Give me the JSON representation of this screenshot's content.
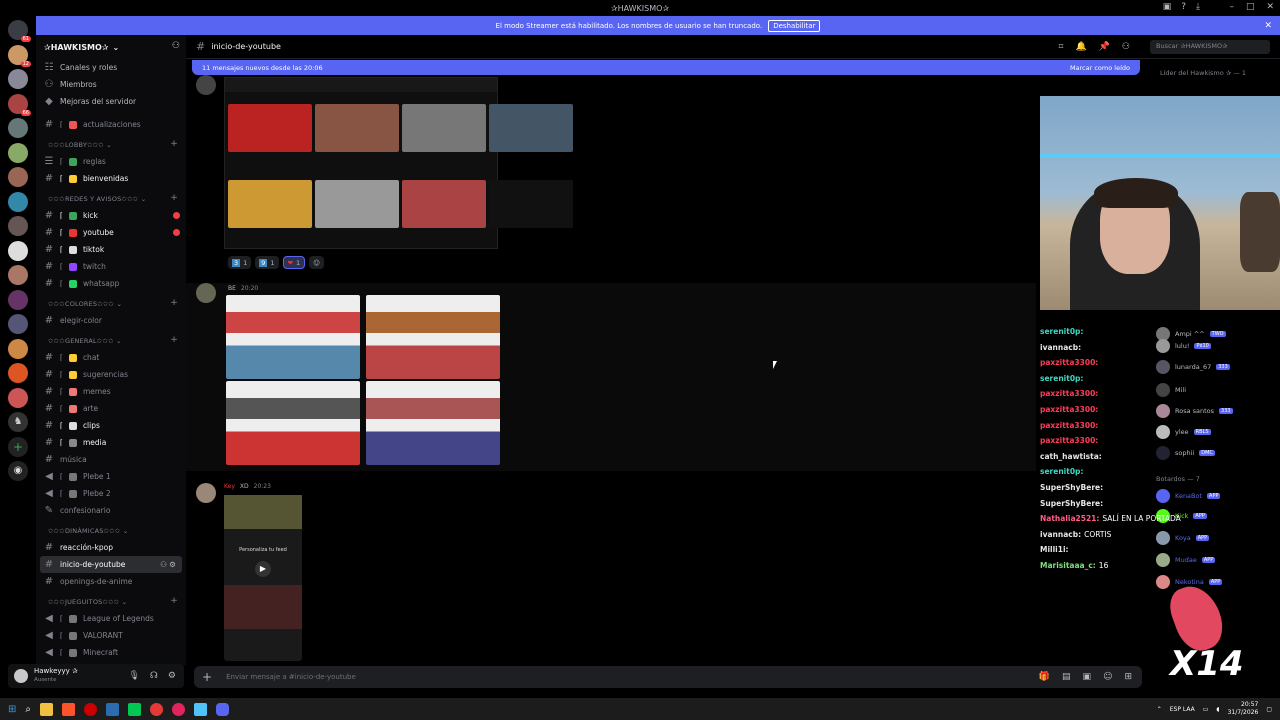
{
  "window": {
    "title": "✰HAWKISMO✰"
  },
  "banner": {
    "text": "El modo Streamer está habilitado. Los nombres de usuario se han truncado.",
    "button": "Deshabilitar"
  },
  "server": {
    "name": "✰HAWKISMO✰"
  },
  "sidebar": {
    "top": [
      "Canales y roles",
      "Miembros",
      "Mejoras del servidor"
    ],
    "channels_pre": [
      {
        "label": "actualizaciones"
      }
    ],
    "cat_lobby": "LOBBY",
    "lobby": [
      {
        "label": "reglas"
      },
      {
        "label": "bienvenidas"
      }
    ],
    "cat_redes": "REDES Y AVISOS",
    "redes": [
      {
        "label": "kick"
      },
      {
        "label": "youtube"
      },
      {
        "label": "tiktok"
      },
      {
        "label": "twitch"
      },
      {
        "label": "whatsapp"
      }
    ],
    "cat_colores": "COLORES",
    "colores": [
      {
        "label": "elegir-color"
      }
    ],
    "cat_general": "GENERAL",
    "general": [
      {
        "label": "chat"
      },
      {
        "label": "sugerencias"
      },
      {
        "label": "memes"
      },
      {
        "label": "arte"
      },
      {
        "label": "clips"
      },
      {
        "label": "media"
      },
      {
        "label": "música"
      },
      {
        "label": "Plebe 1"
      },
      {
        "label": "Plebe 2"
      },
      {
        "label": "confesionario"
      }
    ],
    "cat_dinamicas": "DINÁMICAS",
    "dinamicas": [
      {
        "label": "reacción-kpop"
      },
      {
        "label": "inicio-de-youtube"
      },
      {
        "label": "openings-de-anime"
      }
    ],
    "cat_juegos": "JUEGUITOS",
    "juegos": [
      {
        "label": "League of Legends"
      },
      {
        "label": "VALORANT"
      },
      {
        "label": "Minecraft"
      }
    ]
  },
  "user": {
    "name": "Hawkeyyy ✰",
    "status": "Ausente"
  },
  "channel": {
    "name": "inicio-de-youtube",
    "search_placeholder": "Buscar ✰HAWKISMO✰"
  },
  "newbar": {
    "text": "11 mensajes nuevos desde las 20:06",
    "mark": "Marcar como leído"
  },
  "reactions": [
    {
      "emoji": "3",
      "count": "1"
    },
    {
      "emoji": "9",
      "count": "1"
    },
    {
      "emoji": "❤",
      "count": "1"
    }
  ],
  "messages": [
    {
      "time": "20:20",
      "tag": "BE"
    },
    {
      "author": "Key",
      "time": "20:23",
      "tag": "XD"
    }
  ],
  "composer": {
    "placeholder": "Enviar mensaje a #inicio-de-youtube"
  },
  "chat": [
    {
      "user": "serenit0p:",
      "text": "",
      "color": "#3fd7c0"
    },
    {
      "user": "ivannacb:",
      "text": "",
      "color": "#e6e6e6"
    },
    {
      "user": "paxzitta3300:",
      "text": "",
      "color": "#ff3c5a"
    },
    {
      "user": "serenit0p:",
      "text": "",
      "color": "#3fd7c0"
    },
    {
      "user": "paxzitta3300:",
      "text": "",
      "color": "#ff3c5a"
    },
    {
      "user": "paxzitta3300:",
      "text": "",
      "color": "#ff3c5a"
    },
    {
      "user": "paxzitta3300:",
      "text": "",
      "color": "#ff3c5a"
    },
    {
      "user": "paxzitta3300:",
      "text": "",
      "color": "#ff3c5a"
    },
    {
      "user": "cath_hawtista:",
      "text": "",
      "color": "#e6e6e6"
    },
    {
      "user": "serenit0p:",
      "text": "",
      "color": "#3fd7c0"
    },
    {
      "user": "SuperShyBere:",
      "text": "",
      "color": "#e6e6e6"
    },
    {
      "user": "SuperShyBere:",
      "text": "",
      "color": "#e6e6e6"
    },
    {
      "user": "Nathalia2521:",
      "text": "SALÍ EN LA PORTADA",
      "color": "#ff5c8a"
    },
    {
      "user": "ivannacb:",
      "text": "CORTIS",
      "color": "#e6e6e6"
    },
    {
      "user": "Milli1i:",
      "text": "",
      "color": "#e6e6e6"
    },
    {
      "user": "Marisitaaa_c:",
      "text": "16",
      "color": "#7ee07e"
    }
  ],
  "members": {
    "header": "Líder del Hawkismo ✰ — 1",
    "online": [
      {
        "name": "Ampi ^^",
        "tag": "TWO"
      },
      {
        "name": "lulu!",
        "tag": "Px10"
      },
      {
        "name": "lunarda_67",
        "tag": "333"
      },
      {
        "name": "Mili",
        "tag": ""
      },
      {
        "name": "Rosa santos",
        "tag": "333"
      },
      {
        "name": "ylee",
        "tag": "RBLS"
      },
      {
        "name": "sophii",
        "tag": "DMC"
      }
    ],
    "bots_header": "Botardos — 7",
    "bots": [
      {
        "name": "KenaBot",
        "tag": "APP"
      },
      {
        "name": "Kick",
        "tag": "APP"
      },
      {
        "name": "Koya",
        "tag": "APP"
      },
      {
        "name": "Mudae",
        "tag": "APP"
      },
      {
        "name": "Nekotina",
        "tag": "APP"
      }
    ],
    "overlay": "X14"
  },
  "taskbar": {
    "lang": "ESP LAA",
    "time": "20:57",
    "date": "31/7/2026"
  },
  "colors": {
    "accent": "#5865f2",
    "bg": "#000000",
    "sidebar": "#0b0b0d"
  }
}
